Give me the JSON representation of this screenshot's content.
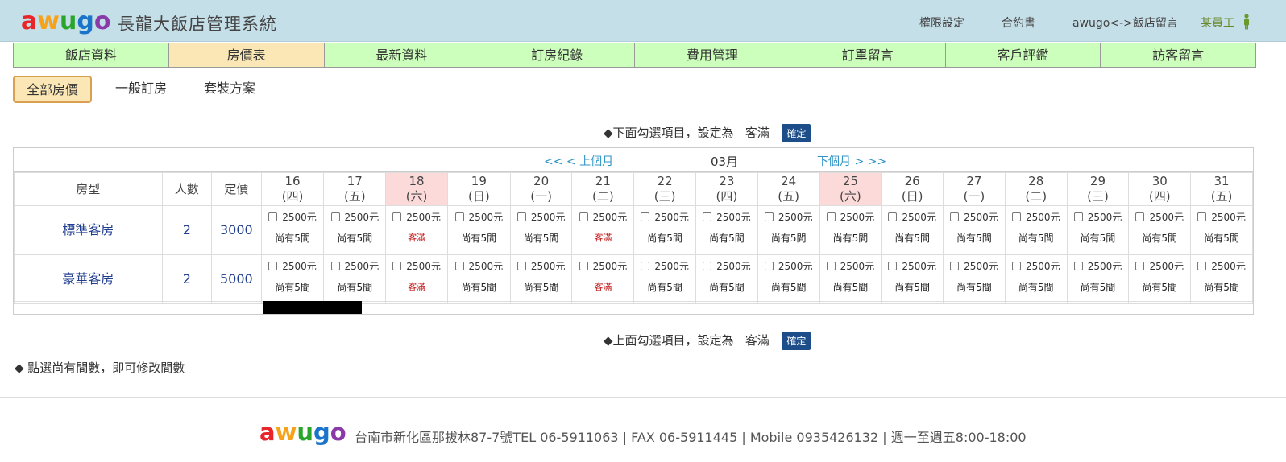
{
  "logo": [
    "a",
    "w",
    "u",
    "g",
    "o"
  ],
  "colors": {
    "logo": [
      "#e8262a",
      "#f7a21b",
      "#2aa52c",
      "#1a74c9",
      "#8a3aa8"
    ],
    "full": "#c21818",
    "weekend": "#fddada",
    "nav_bg": "#ccffbb",
    "nav_active": "#fae7b5",
    "button": "#1d4e89"
  },
  "header": {
    "title": "長龍大飯店管理系統",
    "links": [
      "權限設定",
      "合約書",
      "awugo<->飯店留言"
    ],
    "staff": "某員工"
  },
  "nav": [
    "飯店資料",
    "房價表",
    "最新資料",
    "訂房紀錄",
    "費用管理",
    "訂單留言",
    "客戶評鑑",
    "訪客留言"
  ],
  "nav_active": "房價表",
  "subtabs": [
    "全部房價",
    "一般訂房",
    "套裝方案"
  ],
  "batch_top": {
    "text": "◆下面勾選項目，設定為",
    "status": "客滿",
    "button": "確定"
  },
  "batch_bottom": {
    "text": "◆上面勾選項目，設定為",
    "status": "客滿",
    "button": "確定"
  },
  "calendar": {
    "prev": "<<   < 上個月",
    "month": "03月",
    "next": "下個月 >   >>",
    "headers": {
      "room": "房型",
      "people": "人數",
      "price": "定價"
    },
    "days": [
      {
        "d": "16",
        "w": "(四)"
      },
      {
        "d": "17",
        "w": "(五)"
      },
      {
        "d": "18",
        "w": "(六)",
        "weekend": true
      },
      {
        "d": "19",
        "w": "(日)"
      },
      {
        "d": "20",
        "w": "(一)"
      },
      {
        "d": "21",
        "w": "(二)"
      },
      {
        "d": "22",
        "w": "(三)"
      },
      {
        "d": "23",
        "w": "(四)"
      },
      {
        "d": "24",
        "w": "(五)"
      },
      {
        "d": "25",
        "w": "(六)",
        "weekend": true
      },
      {
        "d": "26",
        "w": "(日)"
      },
      {
        "d": "27",
        "w": "(一)"
      },
      {
        "d": "28",
        "w": "(二)"
      },
      {
        "d": "29",
        "w": "(三)"
      },
      {
        "d": "30",
        "w": "(四)"
      },
      {
        "d": "31",
        "w": "(五)"
      }
    ],
    "rooms": [
      {
        "name": "標準客房",
        "people": "2",
        "price": "3000",
        "day_price": "2500元",
        "avail": "尚有5間",
        "full_days": [
          "18",
          "21"
        ]
      },
      {
        "name": "豪華客房",
        "people": "2",
        "price": "5000",
        "day_price": "2500元",
        "avail": "尚有5間",
        "full_days": [
          "18",
          "21"
        ]
      }
    ],
    "full_label": "客滿"
  },
  "note": "◆ 點選尚有間數，即可修改間數",
  "footer": {
    "info": "台南市新化區那拔林87-7號TEL 06-5911063  |  FAX 06-5911445  |  Mobile 0935426132  |  週一至週五8:00-18:00"
  }
}
